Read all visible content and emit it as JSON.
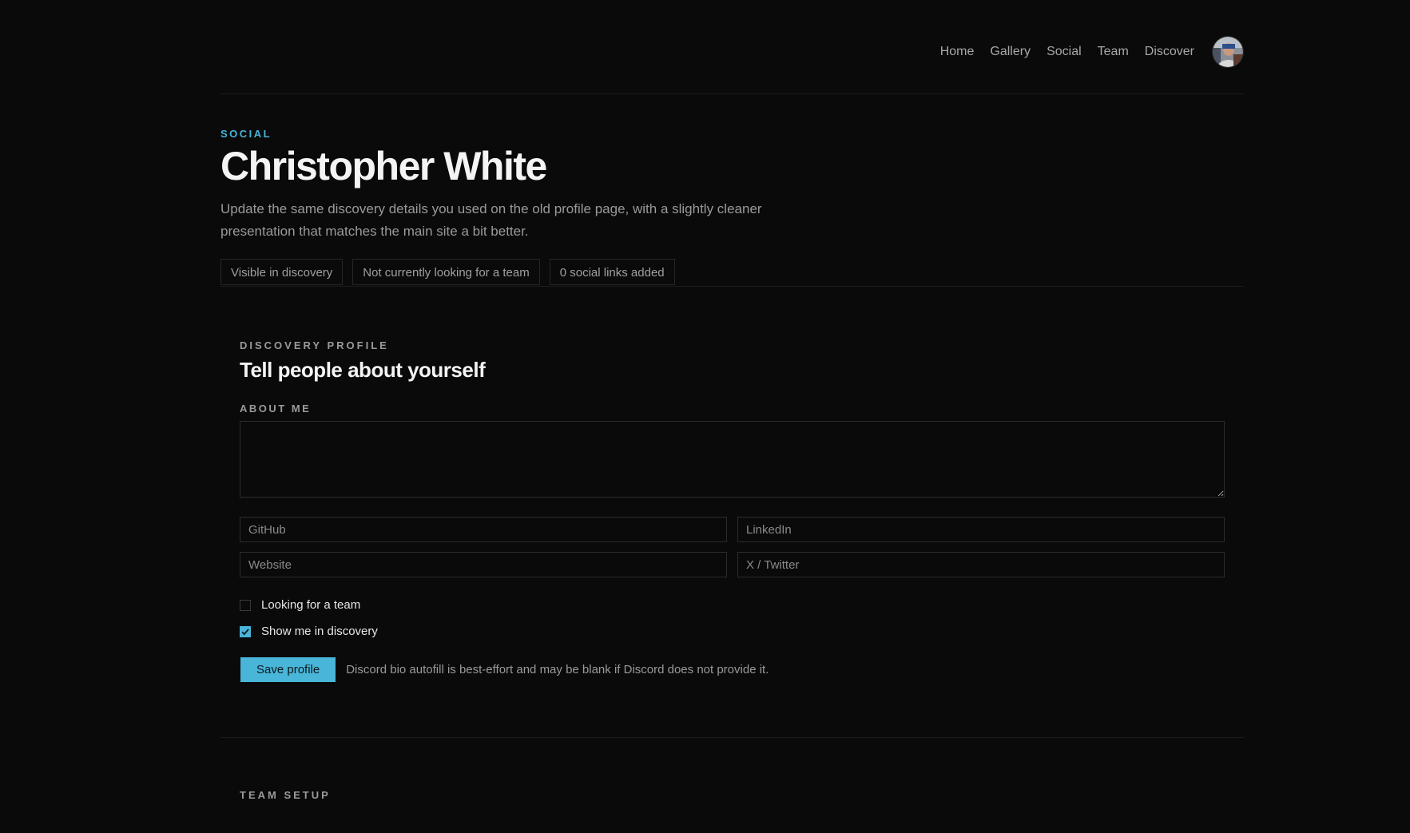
{
  "nav": {
    "items": [
      {
        "label": "Home"
      },
      {
        "label": "Gallery"
      },
      {
        "label": "Social"
      },
      {
        "label": "Team"
      },
      {
        "label": "Discover"
      }
    ]
  },
  "hero": {
    "eyebrow": "SOCIAL",
    "title": "Christopher White",
    "description": "Update the same discovery details you used on the old profile page, with a slightly cleaner presentation that matches the main site a bit better.",
    "pills": [
      {
        "label": "Visible in discovery"
      },
      {
        "label": "Not currently looking for a team"
      },
      {
        "label": "0 social links added"
      }
    ]
  },
  "discovery": {
    "eyebrow": "DISCOVERY PROFILE",
    "title": "Tell people about yourself",
    "about_label": "ABOUT ME",
    "about_value": "",
    "fields": {
      "github_placeholder": "GitHub",
      "linkedin_placeholder": "LinkedIn",
      "website_placeholder": "Website",
      "twitter_placeholder": "X / Twitter"
    },
    "checkboxes": {
      "looking_for_team": {
        "label": "Looking for a team",
        "checked": false
      },
      "show_in_discovery": {
        "label": "Show me in discovery",
        "checked": true
      }
    },
    "save_label": "Save profile",
    "hint": "Discord bio autofill is best-effort and may be blank if Discord does not provide it."
  },
  "team_setup": {
    "eyebrow": "TEAM SETUP"
  },
  "colors": {
    "accent": "#49b5d8",
    "background": "#0a0a0a"
  }
}
